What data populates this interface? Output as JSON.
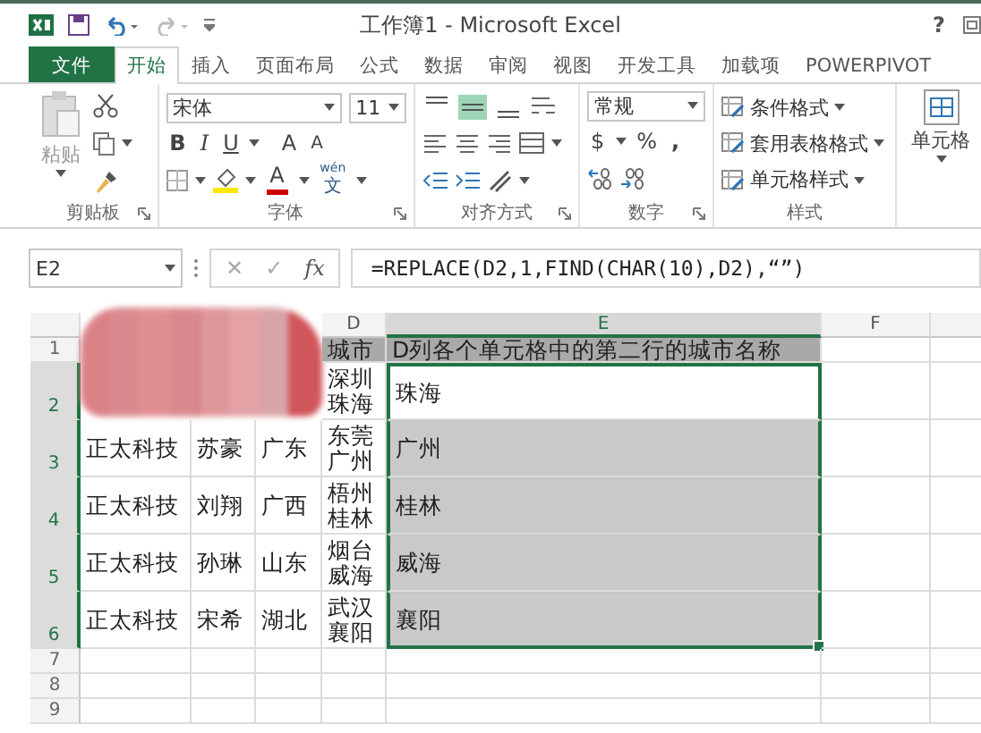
{
  "title_bar": {
    "title": "工作簿1 - Microsoft Excel",
    "help": "?"
  },
  "ribbon_tabs": [
    {
      "label": "文件",
      "kind": "file",
      "selected": false
    },
    {
      "label": "开始",
      "kind": "tab",
      "selected": true
    },
    {
      "label": "插入",
      "kind": "tab",
      "selected": false
    },
    {
      "label": "页面布局",
      "kind": "tab",
      "selected": false
    },
    {
      "label": "公式",
      "kind": "tab",
      "selected": false
    },
    {
      "label": "数据",
      "kind": "tab",
      "selected": false
    },
    {
      "label": "审阅",
      "kind": "tab",
      "selected": false
    },
    {
      "label": "视图",
      "kind": "tab",
      "selected": false
    },
    {
      "label": "开发工具",
      "kind": "tab",
      "selected": false
    },
    {
      "label": "加载项",
      "kind": "tab",
      "selected": false
    },
    {
      "label": "POWERPIVOT",
      "kind": "tab",
      "selected": false
    }
  ],
  "ribbon": {
    "clipboard": {
      "paste": "粘贴",
      "group": "剪贴板"
    },
    "font": {
      "name": "宋体",
      "size": "11",
      "style_buttons": [
        "B",
        "I",
        "U"
      ],
      "grow": "A",
      "shrink": "A",
      "font_color": "A",
      "phonetic_top": "wén",
      "phonetic_bottom": "文",
      "group": "字体"
    },
    "alignment": {
      "vertical_buttons": [
        {
          "kind": "top",
          "selected": false
        },
        {
          "kind": "middle",
          "selected": true
        },
        {
          "kind": "bottom",
          "selected": false
        }
      ],
      "group": "对齐方式"
    },
    "number": {
      "format": "常规",
      "currency": "$",
      "percent": "%",
      "comma": ",",
      "group": "数字"
    },
    "styles": {
      "items": [
        "条件格式",
        "套用表格格式",
        "单元格样式"
      ],
      "group": "样式"
    },
    "cells": {
      "label": "单元格"
    }
  },
  "formula_bar": {
    "name_box": "E2",
    "cancel": "✕",
    "enter": "✓",
    "function_label": "fx",
    "formula": "=REPLACE(D2,1,FIND(CHAR(10),D2),“”)"
  },
  "sheet": {
    "columns": [
      {},
      {},
      {},
      {
        "label": "D",
        "selected": false
      },
      {
        "label": "E",
        "selected": true
      },
      {
        "label": "F",
        "selected": false
      },
      {}
    ],
    "rows": [
      {
        "number": "1",
        "kind": "heading",
        "selected": false,
        "cells": [
          {},
          {},
          {},
          {
            "text": "城市"
          },
          {
            "text": "D列各个单元格中的第二行的城市名称"
          }
        ]
      },
      {
        "number": "2",
        "kind": "data",
        "selected": true,
        "cells": [
          {},
          {},
          {},
          {
            "text": "深圳珠海"
          },
          {
            "text": "珠海",
            "selected": true,
            "active": true
          }
        ]
      },
      {
        "number": "3",
        "kind": "data",
        "selected": true,
        "cells": [
          {
            "text": "正太科技"
          },
          {
            "text": "苏豪"
          },
          {
            "text": "广东"
          },
          {
            "text": "东莞广州"
          },
          {
            "text": "广州",
            "selected": true,
            "active": false
          }
        ]
      },
      {
        "number": "4",
        "kind": "data",
        "selected": true,
        "cells": [
          {
            "text": "正太科技"
          },
          {
            "text": "刘翔"
          },
          {
            "text": "广西"
          },
          {
            "text": "梧州桂林"
          },
          {
            "text": "桂林",
            "selected": true,
            "active": false
          }
        ]
      },
      {
        "number": "5",
        "kind": "data",
        "selected": true,
        "cells": [
          {
            "text": "正太科技"
          },
          {
            "text": "孙琳"
          },
          {
            "text": "山东"
          },
          {
            "text": "烟台威海"
          },
          {
            "text": "威海",
            "selected": true,
            "active": false
          }
        ]
      },
      {
        "number": "6",
        "kind": "data",
        "selected": true,
        "cells": [
          {
            "text": "正太科技"
          },
          {
            "text": "宋希"
          },
          {
            "text": "湖北"
          },
          {
            "text": "武汉襄阳"
          },
          {
            "text": "襄阳",
            "selected": true,
            "active": false
          }
        ]
      },
      {
        "number": "7",
        "kind": "empty",
        "selected": false,
        "cells": []
      },
      {
        "number": "8",
        "kind": "empty",
        "selected": false,
        "cells": []
      },
      {
        "number": "9",
        "kind": "empty",
        "selected": false,
        "cells": []
      }
    ]
  }
}
